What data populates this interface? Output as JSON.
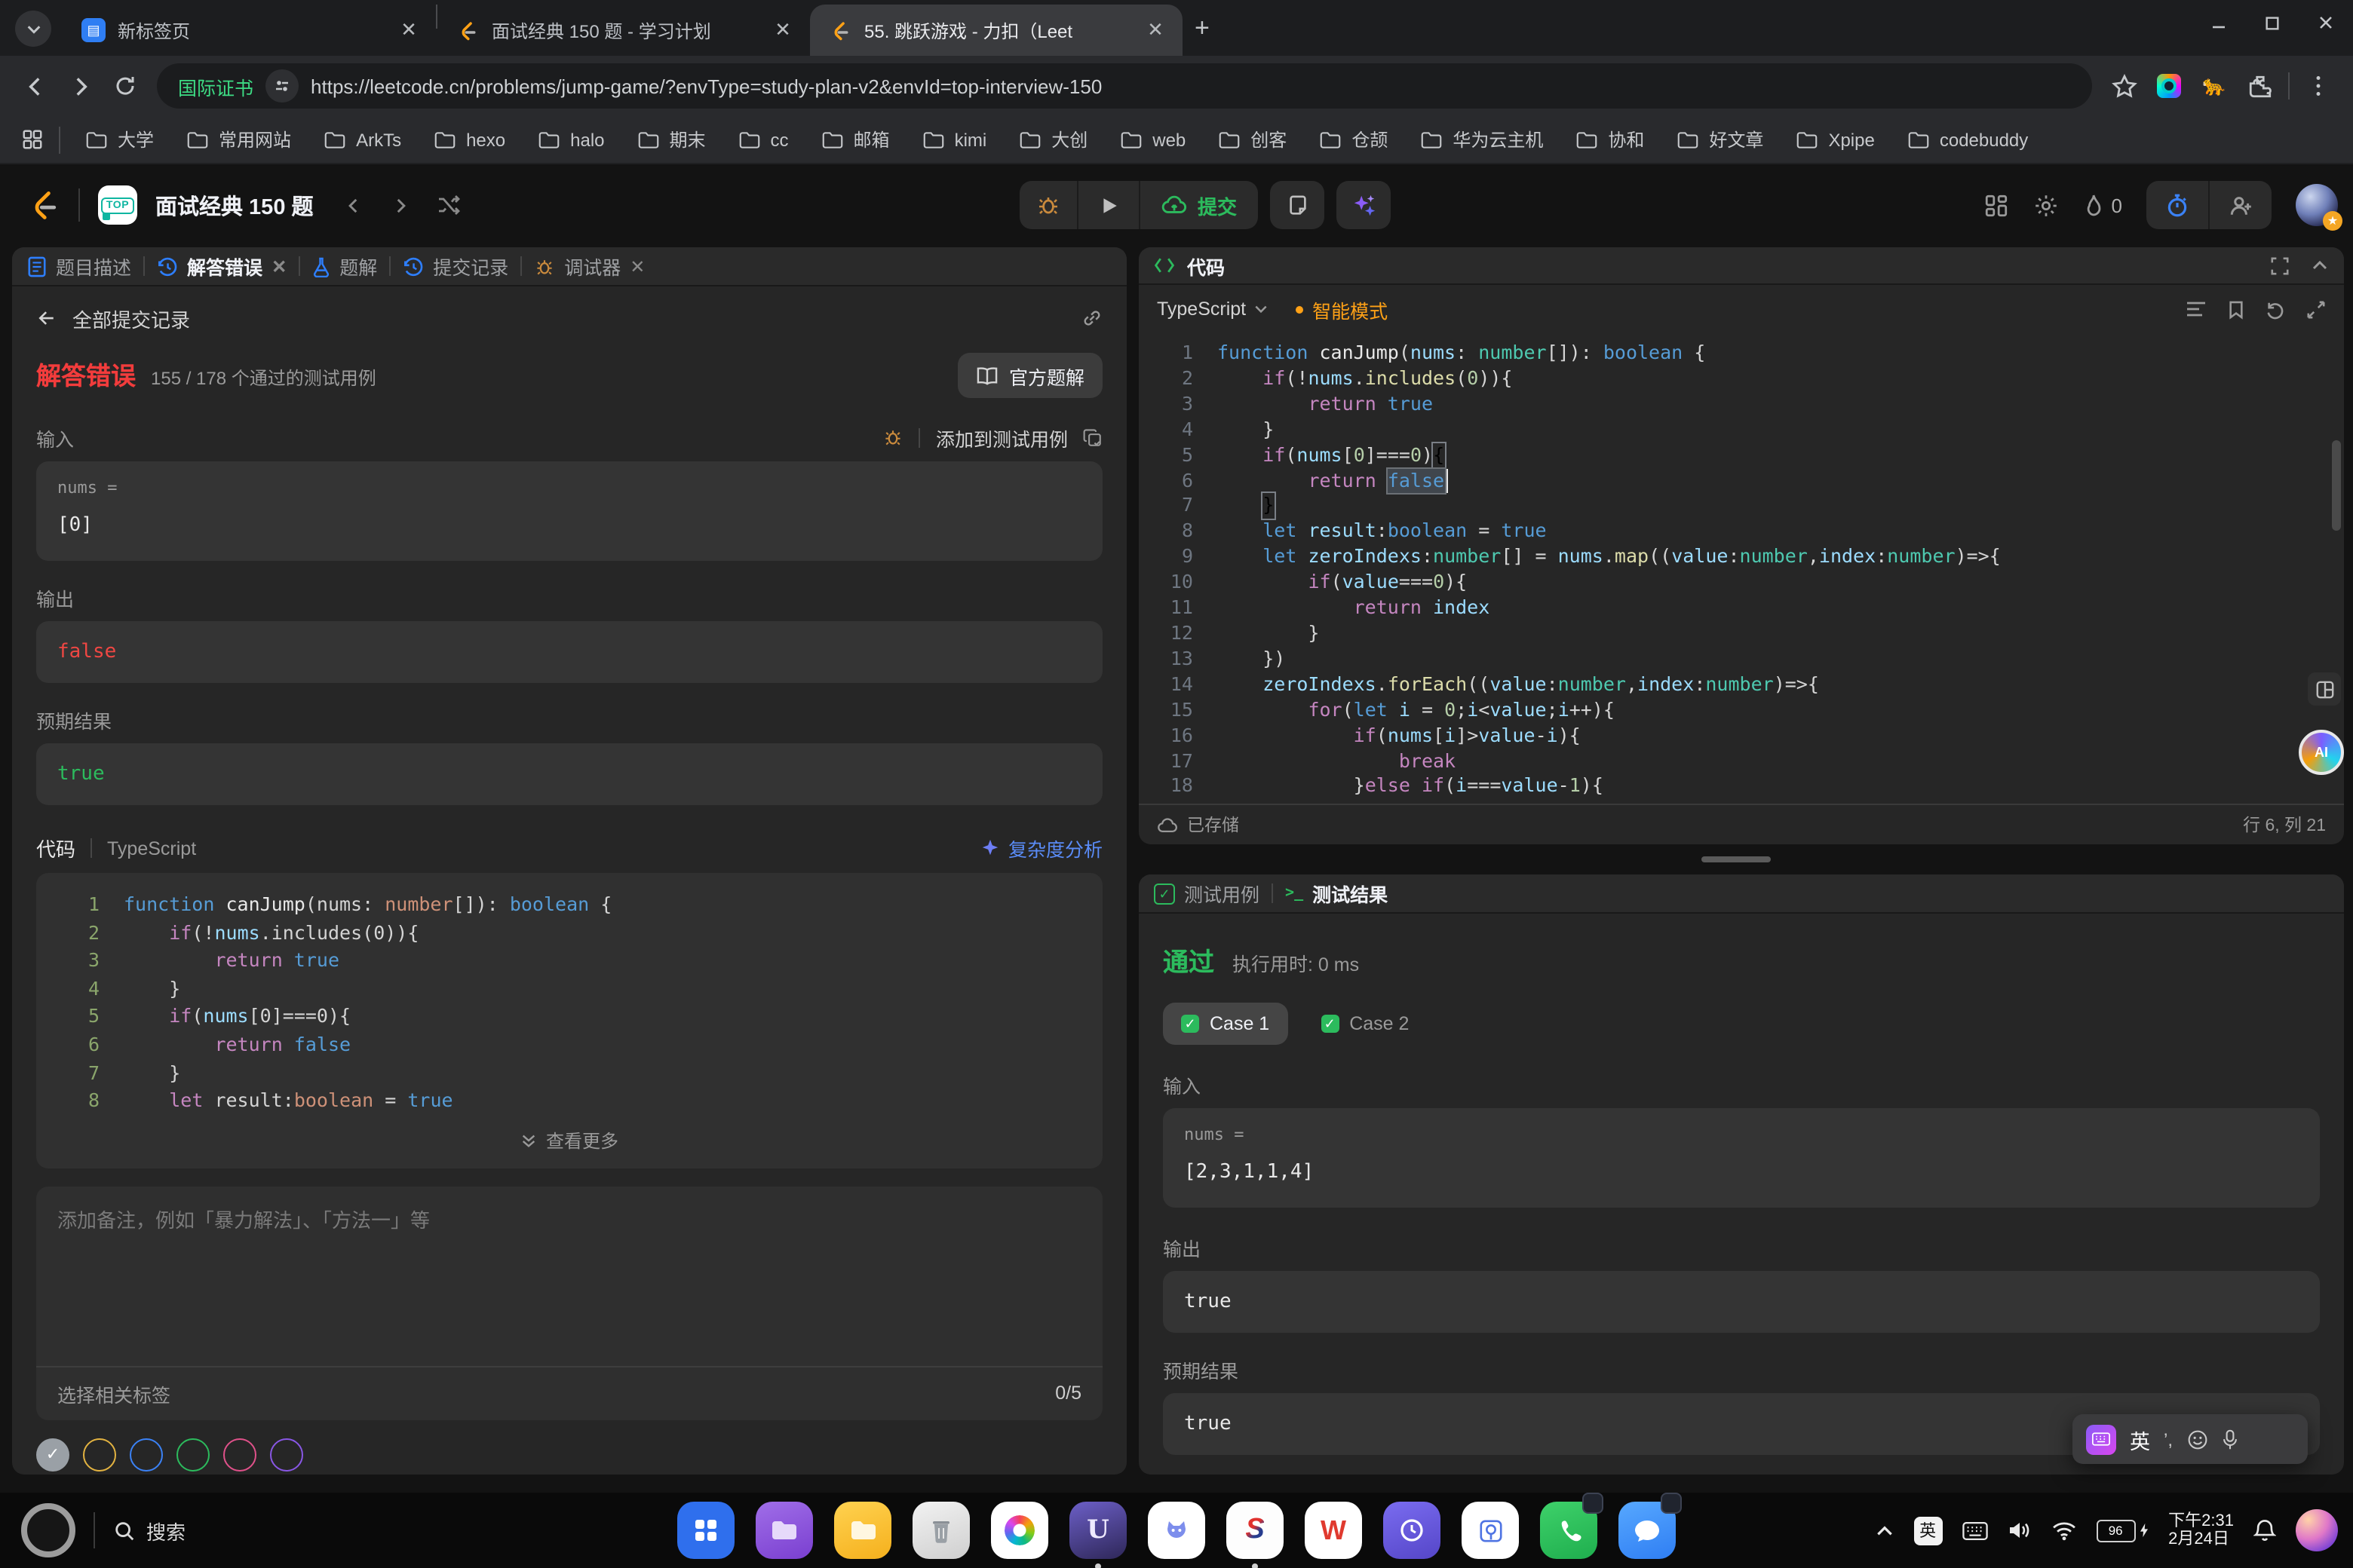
{
  "browser": {
    "tabs": [
      {
        "title": "新标签页",
        "favicon": "doc-blue",
        "active": false
      },
      {
        "title": "面试经典 150 题 - 学习计划",
        "favicon": "leetcode",
        "active": false
      },
      {
        "title": "55. 跳跃游戏 - 力扣（Leet",
        "favicon": "leetcode",
        "active": true
      }
    ],
    "cert_badge": "国际证书",
    "url": "https://leetcode.cn/problems/jump-game/?envType=study-plan-v2&envId=top-interview-150",
    "bookmarks": [
      "大学",
      "常用网站",
      "ArkTs",
      "hexo",
      "halo",
      "期末",
      "cc",
      "邮箱",
      "kimi",
      "大创",
      "web",
      "创客",
      "仓颉",
      "华为云主机",
      "协和",
      "好文章",
      "Xpipe",
      "codebuddy"
    ]
  },
  "header": {
    "plan_title": "面试经典 150 题",
    "submit_label": "提交",
    "streak_count": "0"
  },
  "left_panel": {
    "tabs": [
      {
        "label": "题目描述",
        "icon": "doc-icon",
        "active": false,
        "closable": false
      },
      {
        "label": "解答错误",
        "icon": "history-icon",
        "active": true,
        "closable": true
      },
      {
        "label": "题解",
        "icon": "flask-icon",
        "active": false,
        "closable": false
      },
      {
        "label": "提交记录",
        "icon": "history-icon",
        "active": false,
        "closable": false
      },
      {
        "label": "调试器",
        "icon": "bug-icon",
        "active": false,
        "closable": true
      }
    ],
    "back_label": "全部提交记录",
    "result_title": "解答错误",
    "result_sub": "155 / 178 个通过的测试用例",
    "official_solution": "官方题解",
    "input_label": "输入",
    "add_to_tests": "添加到测试用例",
    "input_name": "nums =",
    "input_value": "[0]",
    "output_label": "输出",
    "output_value": "false",
    "expected_label": "预期结果",
    "expected_value": "true",
    "code_label": "代码",
    "code_lang": "TypeScript",
    "complexity_label": "复杂度分析",
    "view_more": "查看更多",
    "note_placeholder": "添加备注，例如「暴力解法」、「方法一」等",
    "tag_label": "选择相关标签",
    "tag_count": "0/5",
    "tag_colors": [
      "#e3b341",
      "#3b82f6",
      "#2cbb5d",
      "#e0518a",
      "#8957e5"
    ]
  },
  "code_left": {
    "lines": [
      [
        [
          "d",
          "function "
        ],
        [
          "f",
          "canJump"
        ],
        [
          "p",
          "(nums: "
        ],
        [
          "o",
          "number"
        ],
        [
          "p",
          "[]): "
        ],
        [
          "d",
          "boolean"
        ],
        [
          "p",
          " {"
        ]
      ],
      [
        [
          "p",
          "    "
        ],
        [
          "k",
          "if"
        ],
        [
          "p",
          "(!"
        ],
        [
          "v",
          "nums"
        ],
        [
          "p",
          ".includes(0)){"
        ]
      ],
      [
        [
          "p",
          "        "
        ],
        [
          "k",
          "return"
        ],
        [
          "d",
          " true"
        ]
      ],
      [
        [
          "p",
          "    }"
        ]
      ],
      [
        [
          "p",
          "    "
        ],
        [
          "k",
          "if"
        ],
        [
          "p",
          "("
        ],
        [
          "v",
          "nums"
        ],
        [
          "p",
          "[0]===0){"
        ]
      ],
      [
        [
          "p",
          "        "
        ],
        [
          "k",
          "return"
        ],
        [
          "d",
          " false"
        ]
      ],
      [
        [
          "p",
          "    }"
        ]
      ],
      [
        [
          "p",
          "    "
        ],
        [
          "k",
          "let "
        ],
        [
          "p",
          "result:"
        ],
        [
          "o",
          "boolean"
        ],
        [
          "p",
          " = "
        ],
        [
          "d",
          "true"
        ]
      ]
    ]
  },
  "editor": {
    "panel_title": "代码",
    "lang": "TypeScript",
    "mode": "智能模式",
    "saved_label": "已存储",
    "cursor_label": "行 6, 列 21",
    "lines": [
      [
        [
          "d",
          "function "
        ],
        [
          "f",
          "canJump"
        ],
        [
          "p",
          "("
        ],
        [
          "v",
          "nums"
        ],
        [
          "p",
          ": "
        ],
        [
          "t",
          "number"
        ],
        [
          "p",
          "[]): "
        ],
        [
          "d",
          "boolean"
        ],
        [
          "p",
          " {"
        ]
      ],
      [
        [
          "p",
          "    "
        ],
        [
          "k",
          "if"
        ],
        [
          "p",
          "(!"
        ],
        [
          "v",
          "nums"
        ],
        [
          "p",
          "."
        ],
        [
          "m",
          "includes"
        ],
        [
          "p",
          "("
        ],
        [
          "n",
          "0"
        ],
        [
          "p",
          ")){"
        ]
      ],
      [
        [
          "p",
          "        "
        ],
        [
          "k",
          "return"
        ],
        [
          "d",
          " true"
        ]
      ],
      [
        [
          "p",
          "    }"
        ]
      ],
      [
        [
          "p",
          "    "
        ],
        [
          "k",
          "if"
        ],
        [
          "p",
          "("
        ],
        [
          "v",
          "nums"
        ],
        [
          "p",
          "["
        ],
        [
          "n",
          "0"
        ],
        [
          "p",
          "]==="
        ],
        [
          "n",
          "0"
        ],
        [
          "p",
          ")"
        ],
        [
          "brk",
          "{"
        ]
      ],
      [
        [
          "p",
          "        "
        ],
        [
          "k",
          "return "
        ],
        [
          "sel",
          "false"
        ],
        [
          "cur",
          ""
        ]
      ],
      [
        [
          "p",
          "    "
        ],
        [
          "brk",
          "}"
        ]
      ],
      [
        [
          "p",
          "    "
        ],
        [
          "d",
          "let "
        ],
        [
          "v",
          "result"
        ],
        [
          "p",
          ":"
        ],
        [
          "d",
          "boolean"
        ],
        [
          "p",
          " = "
        ],
        [
          "d",
          "true"
        ]
      ],
      [
        [
          "p",
          "    "
        ],
        [
          "d",
          "let "
        ],
        [
          "v",
          "zeroIndexs"
        ],
        [
          "p",
          ":"
        ],
        [
          "t",
          "number"
        ],
        [
          "p",
          "[] = "
        ],
        [
          "v",
          "nums"
        ],
        [
          "p",
          "."
        ],
        [
          "m",
          "map"
        ],
        [
          "p",
          "(("
        ],
        [
          "v",
          "value"
        ],
        [
          "p",
          ":"
        ],
        [
          "t",
          "number"
        ],
        [
          "p",
          ","
        ],
        [
          "v",
          "index"
        ],
        [
          "p",
          ":"
        ],
        [
          "t",
          "number"
        ],
        [
          "p",
          ")=>{"
        ]
      ],
      [
        [
          "p",
          "        "
        ],
        [
          "k",
          "if"
        ],
        [
          "p",
          "("
        ],
        [
          "v",
          "value"
        ],
        [
          "p",
          "==="
        ],
        [
          "n",
          "0"
        ],
        [
          "p",
          "){"
        ]
      ],
      [
        [
          "p",
          "            "
        ],
        [
          "k",
          "return "
        ],
        [
          "v",
          "index"
        ]
      ],
      [
        [
          "p",
          "        }"
        ]
      ],
      [
        [
          "p",
          "    })"
        ]
      ],
      [
        [
          "p",
          "    "
        ],
        [
          "v",
          "zeroIndexs"
        ],
        [
          "p",
          "."
        ],
        [
          "m",
          "forEach"
        ],
        [
          "p",
          "(("
        ],
        [
          "v",
          "value"
        ],
        [
          "p",
          ":"
        ],
        [
          "t",
          "number"
        ],
        [
          "p",
          ","
        ],
        [
          "v",
          "index"
        ],
        [
          "p",
          ":"
        ],
        [
          "t",
          "number"
        ],
        [
          "p",
          ")=>{"
        ]
      ],
      [
        [
          "p",
          "        "
        ],
        [
          "k",
          "for"
        ],
        [
          "p",
          "("
        ],
        [
          "d",
          "let "
        ],
        [
          "v",
          "i"
        ],
        [
          "p",
          " = "
        ],
        [
          "n",
          "0"
        ],
        [
          "p",
          ";"
        ],
        [
          "v",
          "i"
        ],
        [
          "p",
          "<"
        ],
        [
          "v",
          "value"
        ],
        [
          "p",
          ";"
        ],
        [
          "v",
          "i"
        ],
        [
          "p",
          "++){"
        ]
      ],
      [
        [
          "p",
          "            "
        ],
        [
          "k",
          "if"
        ],
        [
          "p",
          "("
        ],
        [
          "v",
          "nums"
        ],
        [
          "p",
          "["
        ],
        [
          "v",
          "i"
        ],
        [
          "p",
          "]>"
        ],
        [
          "v",
          "value"
        ],
        [
          "p",
          "-"
        ],
        [
          "v",
          "i"
        ],
        [
          "p",
          "){"
        ]
      ],
      [
        [
          "p",
          "                "
        ],
        [
          "k",
          "break"
        ]
      ],
      [
        [
          "p",
          "            }"
        ],
        [
          "k",
          "else"
        ],
        [
          "p",
          " "
        ],
        [
          "k",
          "if"
        ],
        [
          "p",
          "("
        ],
        [
          "v",
          "i"
        ],
        [
          "p",
          "==="
        ],
        [
          "v",
          "value"
        ],
        [
          "p",
          "-"
        ],
        [
          "n",
          "1"
        ],
        [
          "p",
          "){"
        ]
      ]
    ]
  },
  "tests": {
    "tab_cases": "测试用例",
    "tab_result": "测试结果",
    "status": "通过",
    "runtime": "执行用时: 0 ms",
    "cases": [
      {
        "label": "Case 1",
        "active": true
      },
      {
        "label": "Case 2",
        "active": false
      }
    ],
    "input_label": "输入",
    "input_name": "nums =",
    "input_value": "[2,3,1,1,4]",
    "output_label": "输出",
    "output_value": "true",
    "expected_label": "预期结果",
    "expected_value": "true"
  },
  "ime": {
    "lang": "英",
    "punct": "’,"
  },
  "dock": {
    "search_label": "搜索",
    "icons": [
      "launcher-grid",
      "files-purple",
      "folder-yellow",
      "trash",
      "photos",
      "app-u",
      "app-pet",
      "app-s",
      "wps-writer",
      "app-clock",
      "app-scan",
      "phone",
      "messages"
    ],
    "running": [
      5,
      7
    ],
    "badged": [
      11,
      12
    ],
    "tray_ime": "英",
    "battery": "96",
    "time": "下午2:31",
    "date": "2月24日"
  },
  "colors": {
    "accent_green": "#2cbb5d",
    "error_red": "#ef4743",
    "link_blue": "#5a8cf8",
    "smart_orange": "#ffa116",
    "cert_green": "#3ddc84"
  }
}
